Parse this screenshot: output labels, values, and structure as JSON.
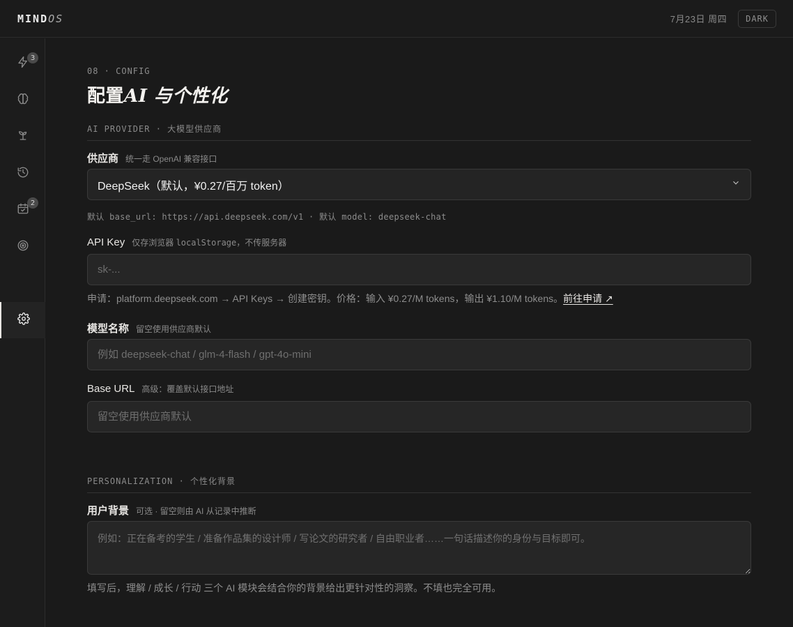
{
  "app": {
    "logo_main": "MIND",
    "logo_suffix": "OS",
    "date": "7月23日 周四",
    "theme_button": "DARK"
  },
  "sidebar": {
    "items": [
      {
        "icon": "lightning-icon",
        "badge": "3"
      },
      {
        "icon": "brain-icon",
        "badge": ""
      },
      {
        "icon": "sprout-icon",
        "badge": ""
      },
      {
        "icon": "history-icon",
        "badge": ""
      },
      {
        "icon": "calendar-check-icon",
        "badge": "2"
      },
      {
        "icon": "target-icon",
        "badge": ""
      },
      {
        "icon": "settings-icon",
        "badge": "",
        "active": true
      }
    ]
  },
  "page": {
    "eyebrow": "08 · CONFIG",
    "title_a": "配置",
    "title_b": "AI",
    "title_c": " 与个性化"
  },
  "ai_provider": {
    "section_head": "AI PROVIDER · 大模型供应商",
    "provider_label": "供应商",
    "provider_hint": "统一走 OpenAI 兼容接口",
    "provider_value": "DeepSeek（默认，¥0.27/百万 token）",
    "provider_defaults": "默认 base_url: https://api.deepseek.com/v1  ·  默认 model: deepseek-chat",
    "api_key_label": "API Key",
    "api_key_hint_a": "仅存浏览器",
    "api_key_hint_mono": "localStorage",
    "api_key_hint_b": "，不传服务器",
    "api_key_placeholder": "sk-...",
    "api_key_note": "申请：platform.deepseek.com → API Keys → 创建密钥。价格：输入 ¥0.27/M tokens，输出 ¥1.10/M tokens。",
    "api_key_link": "前往申请 ↗",
    "model_label": "模型名称",
    "model_hint": "留空使用供应商默认",
    "model_placeholder": "例如 deepseek-chat / glm-4-flash / gpt-4o-mini",
    "base_url_label": "Base URL",
    "base_url_hint": "高级：覆盖默认接口地址",
    "base_url_placeholder": "留空使用供应商默认"
  },
  "personalization": {
    "section_head": "PERSONALIZATION · 个性化背景",
    "bg_label": "用户背景",
    "bg_hint": "可选 · 留空则由 AI 从记录中推断",
    "bg_placeholder": "例如：正在备考的学生 / 准备作品集的设计师 / 写论文的研究者 / 自由职业者……一句话描述你的身份与目标即可。",
    "bg_note": "填写后，理解 / 成长 / 行动 三个 AI 模块会结合你的背景给出更针对性的洞察。不填也完全可用。"
  }
}
